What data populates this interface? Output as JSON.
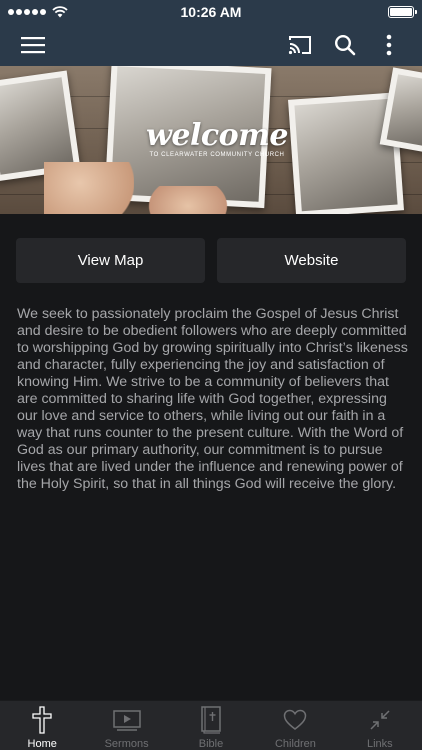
{
  "status_bar": {
    "time": "10:26 AM"
  },
  "nav": {
    "icons": [
      "menu-icon",
      "cast-icon",
      "search-icon",
      "more-vertical-icon"
    ]
  },
  "hero": {
    "title": "welcome",
    "subtitle": "TO CLEARWATER COMMUNITY CHURCH"
  },
  "actions": {
    "view_map": "View Map",
    "website": "Website"
  },
  "description": "We seek to passionately proclaim the Gospel of Jesus Christ and desire to be obedient followers who are deeply committed to worshipping God by growing spiritually into Christ’s likeness and character, fully experiencing the joy and satisfaction of knowing Him. We strive to be a community of believers that are committed to sharing life with God together, expressing our love and service to others, while living out our faith in a way that runs counter to the present culture. With the Word of God as our primary authority, our commitment is to pursue lives that are lived under the influence and renewing power of the Holy Spirit, so that in all things God will receive the glory.",
  "tabs": [
    {
      "label": "Home",
      "icon": "cross-icon",
      "active": true
    },
    {
      "label": "Sermons",
      "icon": "video-icon",
      "active": false
    },
    {
      "label": "Bible",
      "icon": "bible-icon",
      "active": false
    },
    {
      "label": "Children",
      "icon": "heart-icon",
      "active": false
    },
    {
      "label": "Links",
      "icon": "links-icon",
      "active": false
    }
  ],
  "colors": {
    "header": "#2b3a4a",
    "background": "#161719",
    "button": "#26272a",
    "body_text": "#a5a6a9",
    "tab_inactive": "#6f7073"
  }
}
